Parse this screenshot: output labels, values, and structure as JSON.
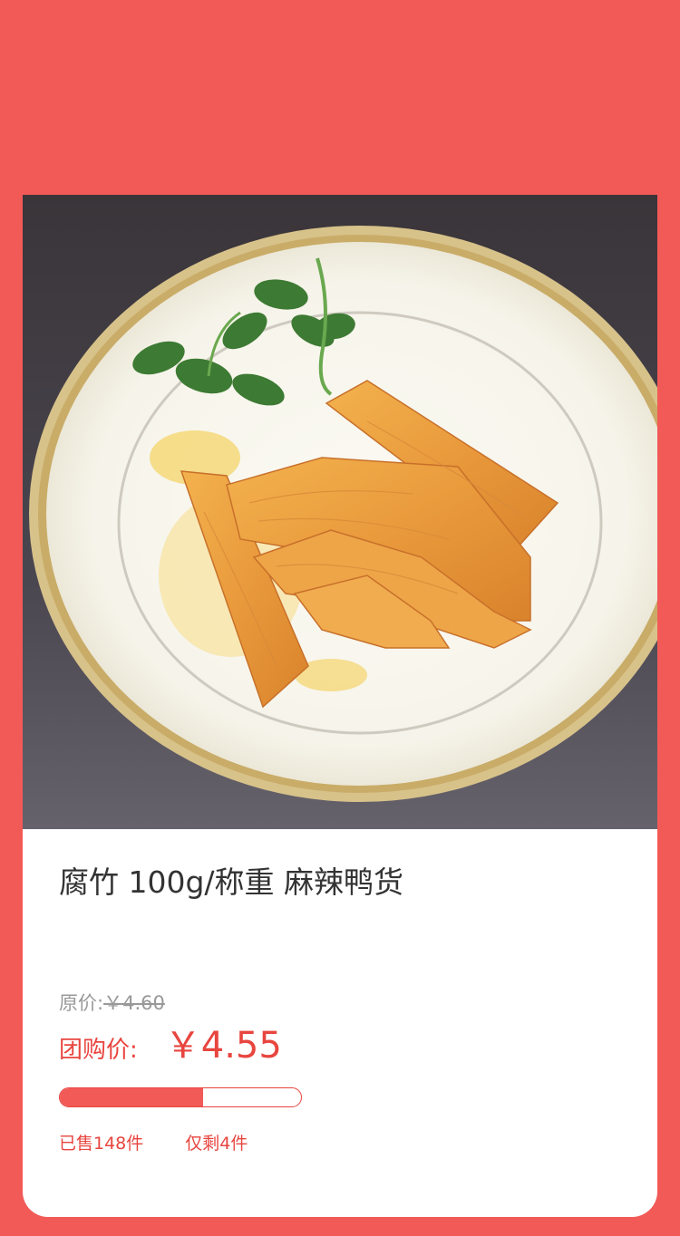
{
  "product": {
    "title": "腐竹 100g/称重 麻辣鸭货",
    "image_icon": "dish-photo-icon"
  },
  "pricing": {
    "original_label": "原价:",
    "original_price": "￥4.60",
    "group_label": "团购价:",
    "group_price": "￥4.55"
  },
  "sales": {
    "sold_text": "已售148件",
    "remaining_text": "仅剩4件",
    "progress_fraction": 0.594
  },
  "colors": {
    "background": "#F25A57",
    "accent": "#E8453F",
    "card": "#FFFFFF"
  }
}
